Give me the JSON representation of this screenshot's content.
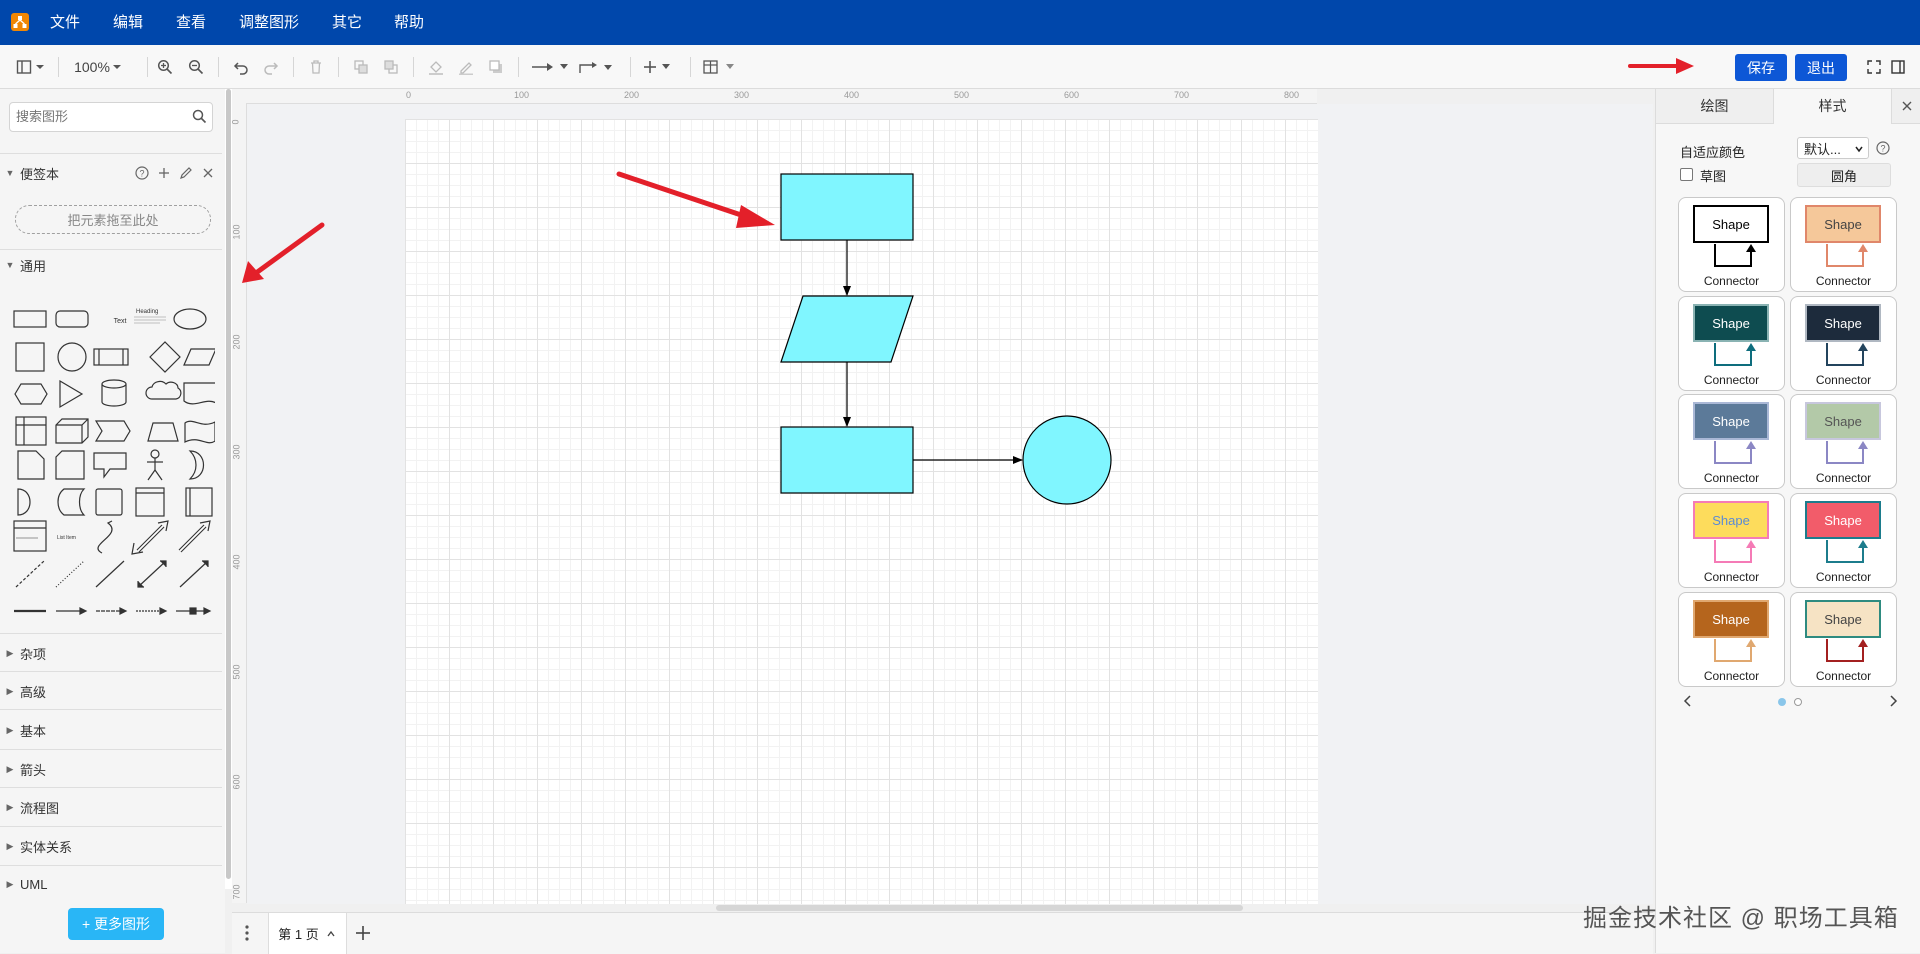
{
  "menubar": {
    "items": [
      "文件",
      "编辑",
      "查看",
      "调整图形",
      "其它",
      "帮助"
    ],
    "bg": "#0047ab"
  },
  "toolbar": {
    "zoom": "100%",
    "save_label": "保存",
    "exit_label": "退出"
  },
  "sidebar": {
    "search_placeholder": "搜索图形",
    "scratchpad_title": "便签本",
    "drop_hint": "把元素拖至此处",
    "general_title": "通用",
    "shape_text_sample": "Text",
    "shape_heading_sample": "Heading",
    "shape_list_item_sample": "List Item",
    "sections": [
      "杂项",
      "高级",
      "基本",
      "箭头",
      "流程图",
      "实体关系",
      "UML"
    ],
    "more_shapes": "+ 更多图形"
  },
  "ruler": {
    "top_ticks": [
      "0",
      "100",
      "200",
      "300",
      "400",
      "500",
      "600",
      "700",
      "800"
    ],
    "left_ticks": [
      "0",
      "100",
      "200",
      "300",
      "400",
      "500",
      "600",
      "700"
    ]
  },
  "diagram": {
    "fill": "#80f6ff",
    "stroke": "#000000",
    "shapes": [
      "rectangle",
      "parallelogram",
      "rectangle",
      "circle"
    ]
  },
  "pages": {
    "current": "第 1 页"
  },
  "right_panel": {
    "tabs": [
      "绘图",
      "样式"
    ],
    "active_tab": "样式",
    "adaptive_color_label": "自适应颜色",
    "adaptive_color_value": "默认...",
    "sketch_label": "草图",
    "rounded_label": "圆角",
    "styles": [
      {
        "shape": "Shape",
        "connector": "Connector",
        "fill": "#ffffff",
        "stroke": "#000000",
        "text": "#000000",
        "line": "#000000"
      },
      {
        "shape": "Shape",
        "connector": "Connector",
        "fill": "#f5c89a",
        "stroke": "#e0876a",
        "text": "#444444",
        "line": "#e0876a"
      },
      {
        "shape": "Shape",
        "connector": "Connector",
        "fill": "#0e4c50",
        "stroke": "#8ab3b3",
        "text": "#ffffff",
        "line": "#0e6d7d"
      },
      {
        "shape": "Shape",
        "connector": "Connector",
        "fill": "#1d2b3c",
        "stroke": "#b0b8c2",
        "text": "#ffffff",
        "line": "#23445d"
      },
      {
        "shape": "Shape",
        "connector": "Connector",
        "fill": "#5c7a99",
        "stroke": "#aab8d6",
        "text": "#ffffff",
        "line": "#8b87c4"
      },
      {
        "shape": "Shape",
        "connector": "Connector",
        "fill": "#b3c9a8",
        "stroke": "#c7c7dd",
        "text": "#555555",
        "line": "#8b87c4"
      },
      {
        "shape": "Shape",
        "connector": "Connector",
        "fill": "#fddc5c",
        "stroke": "#f57bb6",
        "text": "#5a8bd6",
        "line": "#f57bb6"
      },
      {
        "shape": "Shape",
        "connector": "Connector",
        "fill": "#f25c6a",
        "stroke": "#1c7c8c",
        "text": "#ffffff",
        "line": "#1c7c8c"
      },
      {
        "shape": "Shape",
        "connector": "Connector",
        "fill": "#b5651d",
        "stroke": "#e0a870",
        "text": "#ffffff",
        "line": "#e0a870"
      },
      {
        "shape": "Shape",
        "connector": "Connector",
        "fill": "#f6e3c4",
        "stroke": "#2e8b80",
        "text": "#444444",
        "line": "#a32020"
      }
    ]
  },
  "annotations": {
    "arrow_color": "#e3202a"
  },
  "watermark": "掘金技术社区 @ 职场工具箱"
}
